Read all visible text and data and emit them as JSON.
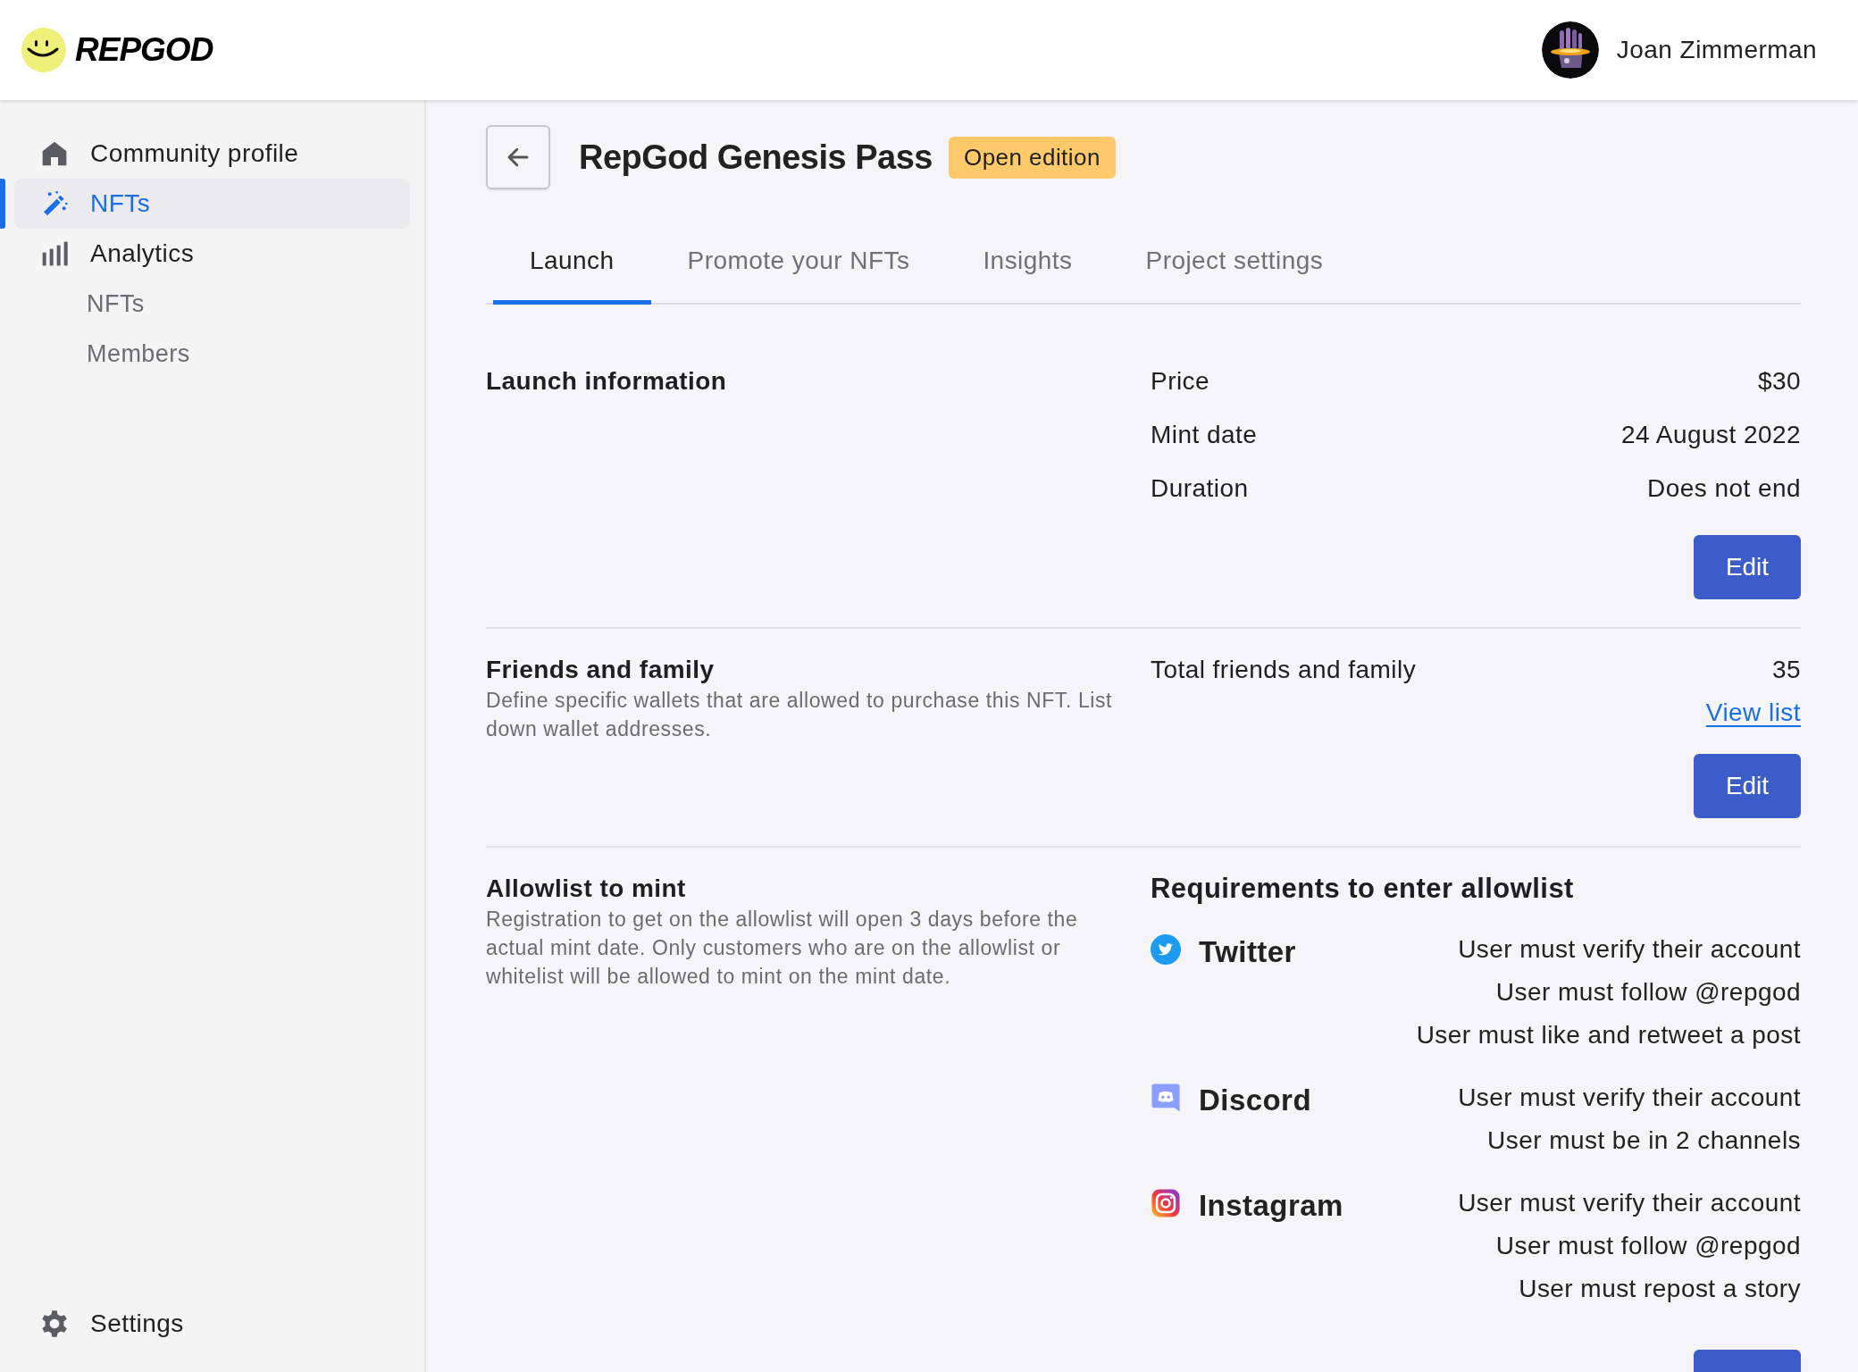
{
  "header": {
    "logo": "REPGOD",
    "user": {
      "name": "Joan Zimmerman"
    }
  },
  "sidebar": {
    "items": [
      {
        "label": "Community profile",
        "kind": "home",
        "selected": false
      },
      {
        "label": "NFTs",
        "kind": "wand",
        "selected": true
      },
      {
        "label": "Analytics",
        "kind": "chart",
        "selected": false,
        "children": [
          {
            "label": "NFTs",
            "selected": false
          },
          {
            "label": "Members",
            "selected": false
          }
        ]
      }
    ],
    "footer": {
      "label": "Settings"
    }
  },
  "page": {
    "title": "RepGod Genesis Pass",
    "badge": "Open edition"
  },
  "tabs": [
    {
      "label": "Launch",
      "selected": true
    },
    {
      "label": "Promote your NFTs",
      "selected": false
    },
    {
      "label": "Insights",
      "selected": false
    },
    {
      "label": "Project settings",
      "selected": false
    }
  ],
  "sections": [
    {
      "kind": "info",
      "heading": "Launch information",
      "rows": [
        {
          "label": "Price",
          "value": "$30"
        },
        {
          "label": "Mint date",
          "value": "24 August 2022"
        },
        {
          "label": "Duration",
          "value": "Does not end"
        }
      ],
      "action": {
        "kind": "button",
        "label": "Edit"
      }
    },
    {
      "kind": "list",
      "heading": "Friends and family",
      "description": "Define specific wallets that are allowed to purchase this NFT. List down wallet addresses.",
      "rows": [
        {
          "label": "Total friends and family",
          "value": "35"
        }
      ],
      "link": "View list",
      "action": {
        "kind": "button",
        "label": "Edit"
      }
    },
    {
      "kind": "requirements",
      "heading": "Allowlist to mint",
      "description": "Registration to get on the allowlist will open 3 days before the actual mint date. Only customers who are on the allowlist or whitelist will be allowed to mint on the mint date.",
      "requirements_title": "Requirements to enter allowlist",
      "platforms": [
        {
          "name": "Twitter",
          "kind": "twitter",
          "items": [
            "User must verify their account",
            "User must follow @repgod",
            "User must like and retweet a post"
          ]
        },
        {
          "name": "Discord",
          "kind": "discord",
          "items": [
            "User must verify their account",
            "User must be in 2 channels"
          ]
        },
        {
          "name": "Instagram",
          "kind": "instagram",
          "items": [
            "User must verify their account",
            "User must follow @repgod",
            "User must repost a story"
          ]
        }
      ],
      "action": {
        "kind": "button"
      }
    }
  ]
}
